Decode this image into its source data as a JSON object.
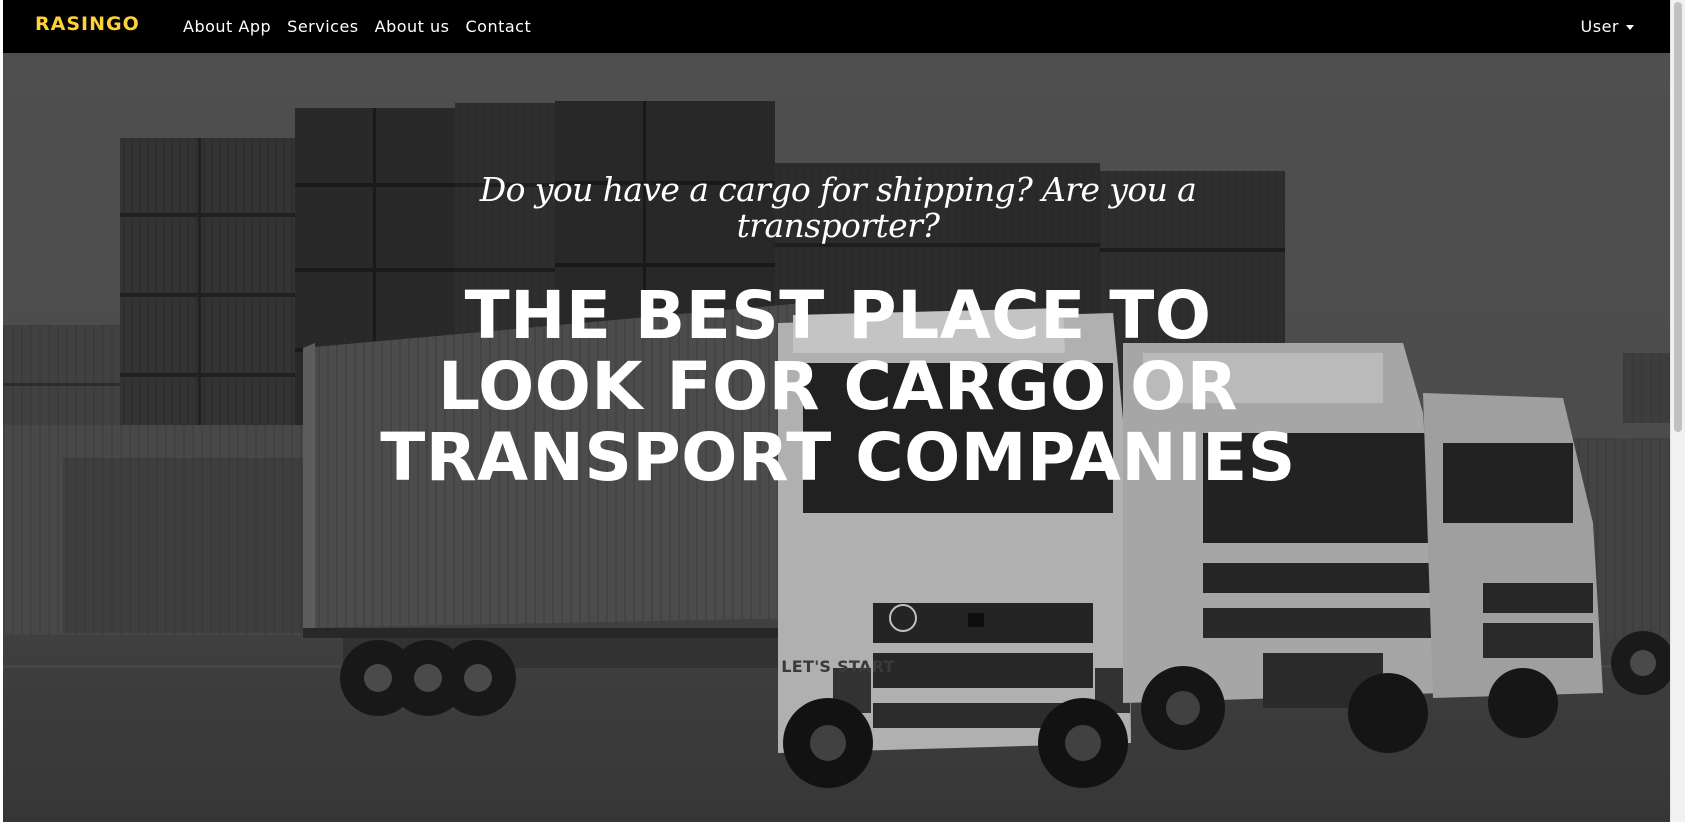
{
  "navbar": {
    "brand": "RASINGO",
    "links": [
      {
        "label": "About App"
      },
      {
        "label": "Services"
      },
      {
        "label": "About us"
      },
      {
        "label": "Contact"
      }
    ],
    "user_menu": {
      "label": "User"
    }
  },
  "hero": {
    "subheading": "Do you have a cargo for shipping? Are you a transporter?",
    "heading": "THE BEST PLACE TO LOOK FOR CARGO OR TRANSPORT COMPANIES",
    "cta_label": "LET'S START",
    "background_image": "grayscale photo of stacked shipping containers and white semi trucks"
  },
  "colors": {
    "navbar_bg": "#000000",
    "brand": "#fed136",
    "hero_text": "#ffffff"
  },
  "icons": {
    "user_caret": "caret-down-icon"
  }
}
